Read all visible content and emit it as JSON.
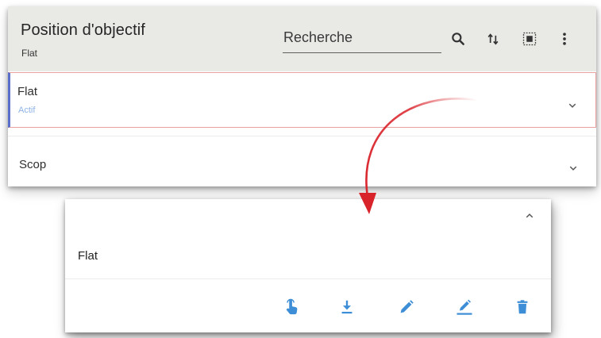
{
  "header": {
    "title": "Position d'objectif",
    "subtitle": "Flat",
    "search_placeholder": "Recherche"
  },
  "toolbar": {
    "icons": [
      "search-icon",
      "sort-icon",
      "select-all-icon",
      "more-vert-icon"
    ]
  },
  "list": {
    "items": [
      {
        "label": "Flat",
        "status": "Actif"
      },
      {
        "label": "Scop",
        "status": ""
      }
    ]
  },
  "detail": {
    "name": "Flat",
    "actions": [
      "touch-icon",
      "download-icon",
      "edit-icon",
      "edit-underline-icon",
      "delete-icon"
    ]
  },
  "colors": {
    "header_bg": "#e9e9e6",
    "accent_blue": "#3d8ed6",
    "status_text": "#8fb3e6",
    "selected_border": "#e8a0a0",
    "selected_left_bar": "#5a6fc9",
    "annotation_arrow": "#d9232a"
  }
}
